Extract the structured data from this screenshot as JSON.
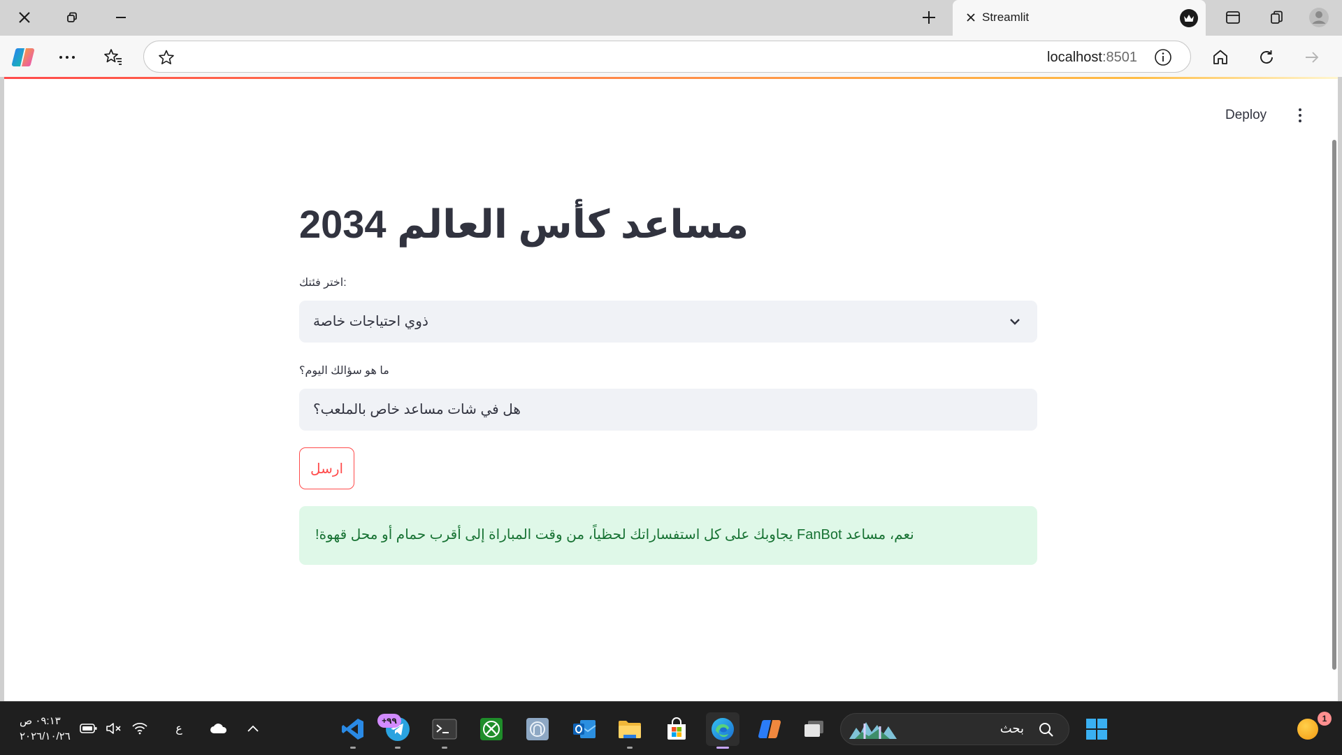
{
  "browser": {
    "tab": {
      "title": "Streamlit"
    },
    "address": {
      "host": "localhost",
      "port": ":8501"
    }
  },
  "streamlit": {
    "deploy_label": "Deploy"
  },
  "page": {
    "title": "مساعد كأس العالم 2034",
    "category_label": ":اختر فئتك",
    "category_value": "ذوي احتياجات خاصة",
    "question_label": "ما هو سؤالك اليوم؟",
    "question_value": "هل في شات مساعد خاص بالملعب؟",
    "send_label": "ارسل",
    "answer": "!يجاوبك على كل استفساراتك لحظياً، من وقت المباراة إلى أقرب حمام أو محل قهوة FanBot نعم، مساعد"
  },
  "taskbar": {
    "time": "٠٩:١٣ ص",
    "date": "٢٠٢٦/١٠/٢٦",
    "language": "ع",
    "telegram_badge": "+٩٩",
    "search_placeholder": "بحث",
    "notification_count": "1"
  }
}
